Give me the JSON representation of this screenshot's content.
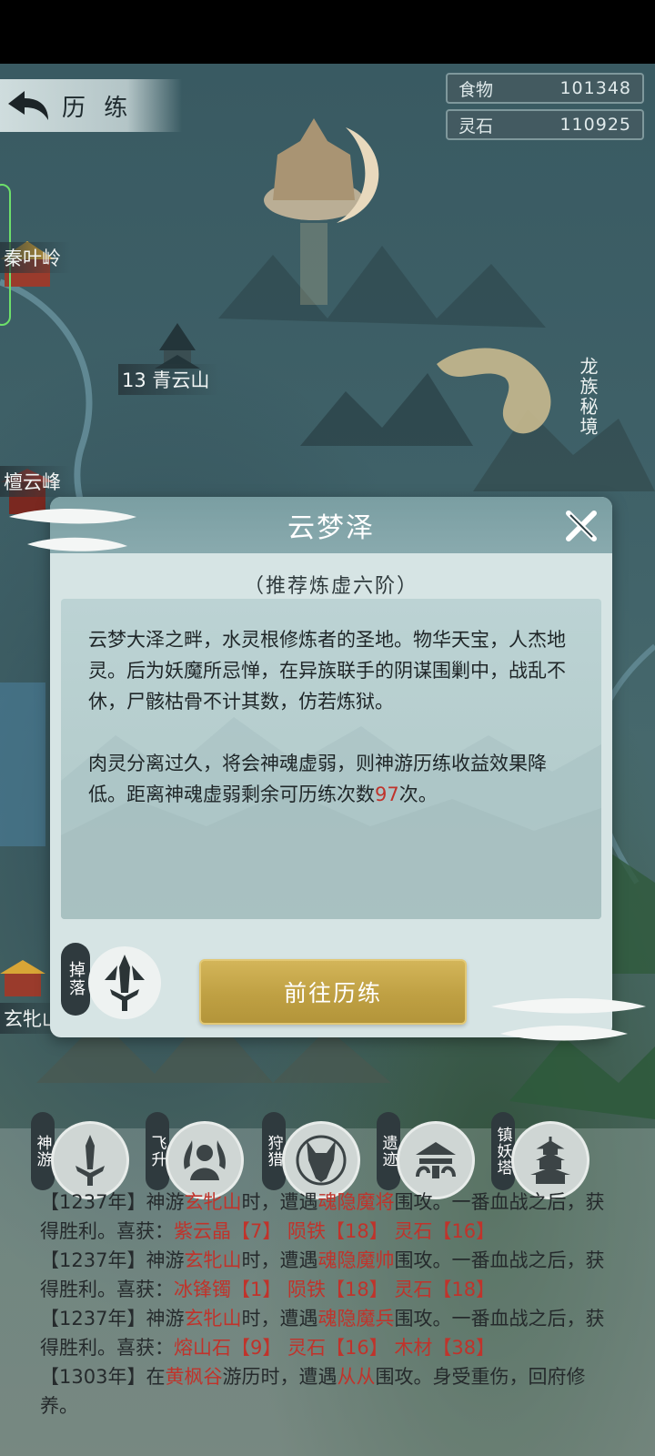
{
  "header": {
    "back_label": "历 练"
  },
  "resources": [
    {
      "label": "食物",
      "value": "101348"
    },
    {
      "label": "灵石",
      "value": "110925"
    }
  ],
  "map": {
    "labels": {
      "qinyeling": "秦叶岭",
      "qingyunshan": "13 青云山",
      "tanyunfeng": "檀云峰",
      "xuanpinshan": "玄牝山"
    },
    "dragon_realm": "龙族秘境"
  },
  "dialog": {
    "title": "云梦泽",
    "subtitle": "（推荐炼虚六阶）",
    "paragraph1": "云梦大泽之畔，水灵根修炼者的圣地。物华天宝，人杰地灵。后为妖魔所忌惮，在异族联手的阴谋围剿中，战乱不休，尸骸枯骨不计其数，仿若炼狱。",
    "paragraph2_prefix": "肉灵分离过久，将会神魂虚弱，则神游历练收益效果降低。距离神魂虚弱剩余可历练次数",
    "remaining_count": "97",
    "paragraph2_suffix": "次。",
    "drop_label": "掉落",
    "go_button": "前往历练"
  },
  "features": [
    {
      "tag": "神游",
      "icon": "sword-icon"
    },
    {
      "tag": "飞升",
      "icon": "ascension-icon"
    },
    {
      "tag": "狩猎",
      "icon": "wolf-icon"
    },
    {
      "tag": "遗迹",
      "icon": "ruins-icon"
    },
    {
      "tag": "镇妖塔",
      "icon": "pagoda-icon"
    }
  ],
  "log": [
    {
      "parts": [
        [
          "",
          "【1237年】神游"
        ],
        [
          "hl",
          "玄牝山"
        ],
        [
          "",
          "时，遭遇"
        ],
        [
          "hl",
          "魂隐魔将"
        ],
        [
          "",
          "围攻。一番血战之后，获得胜利。喜获："
        ],
        [
          "hl",
          "紫云晶【7】 陨铁【18】 灵石【16】"
        ]
      ]
    },
    {
      "parts": [
        [
          "",
          "【1237年】神游"
        ],
        [
          "hl",
          "玄牝山"
        ],
        [
          "",
          "时，遭遇"
        ],
        [
          "hl",
          "魂隐魔帅"
        ],
        [
          "",
          "围攻。一番血战之后，获得胜利。喜获："
        ],
        [
          "hl",
          "冰锋镯【1】 陨铁【18】 灵石【18】"
        ]
      ]
    },
    {
      "parts": [
        [
          "",
          "【1237年】神游"
        ],
        [
          "hl",
          "玄牝山"
        ],
        [
          "",
          "时，遭遇"
        ],
        [
          "hl",
          "魂隐魔兵"
        ],
        [
          "",
          "围攻。一番血战之后，获得胜利。喜获："
        ],
        [
          "hl",
          "熔山石【9】 灵石【16】 木材【38】"
        ]
      ]
    },
    {
      "parts": [
        [
          "",
          "【1303年】在"
        ],
        [
          "hl",
          "黄枫谷"
        ],
        [
          "",
          "游历时，遭遇"
        ],
        [
          "hl",
          "从从"
        ],
        [
          "",
          "围攻。身受重伤，回府修养。"
        ]
      ]
    }
  ]
}
